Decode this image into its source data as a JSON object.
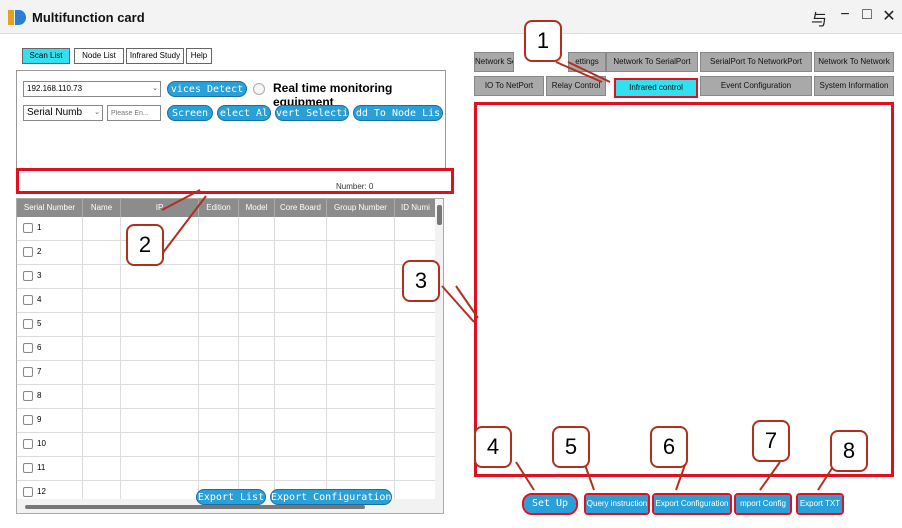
{
  "window": {
    "title": "Multifunction card",
    "controls": {
      "pin": "与",
      "minimize": "−",
      "maximize": "□",
      "close": "✕"
    }
  },
  "left_tabs": [
    "Scan List",
    "Node List",
    "Infrared Study",
    "Help"
  ],
  "scan": {
    "ip_value": "192.168.110.73",
    "detect_button": "vices Detect",
    "realtime_label": "Real time monitoring equipment",
    "filter_select": "Serial Numb",
    "filter_placeholder": "Please En...",
    "screen_button": "Screen",
    "select_all_button": "elect Al",
    "invert_button": "vert Selecti",
    "add_node_button": "dd To Node Lis",
    "number_label": "Number: 0"
  },
  "grid": {
    "columns": [
      "Serial Number",
      "Name",
      "IP",
      "Edition",
      "Model",
      "Core Board",
      "Group Number",
      "ID Numi"
    ],
    "rows": [
      "1",
      "2",
      "3",
      "4",
      "5",
      "6",
      "7",
      "8",
      "9",
      "10",
      "11",
      "12"
    ]
  },
  "left_buttons": {
    "export_list": "Export List",
    "export_config": "Export Configuration"
  },
  "right_tabs_row1": [
    "Network Se",
    "ettings",
    "Network To SerialPort",
    "SerialPort To NetworkPort",
    "Network To Network"
  ],
  "right_tabs_row2": [
    "IO To NetPort",
    "Relay Control",
    "Infrared control",
    "Event Configuration",
    "System Information"
  ],
  "bottom_buttons": {
    "set_up": "Set Up",
    "query": "Query instruction",
    "export_config": "Export Configuration",
    "import_config": "mport Config",
    "export_txt": "Export TXT"
  },
  "callouts": [
    "1",
    "2",
    "3",
    "4",
    "5",
    "6",
    "7",
    "8"
  ],
  "colors": {
    "accent": "#33e0f0",
    "button": "#2aa0d8",
    "highlight": "#e01020",
    "header": "#8c8c8c"
  }
}
